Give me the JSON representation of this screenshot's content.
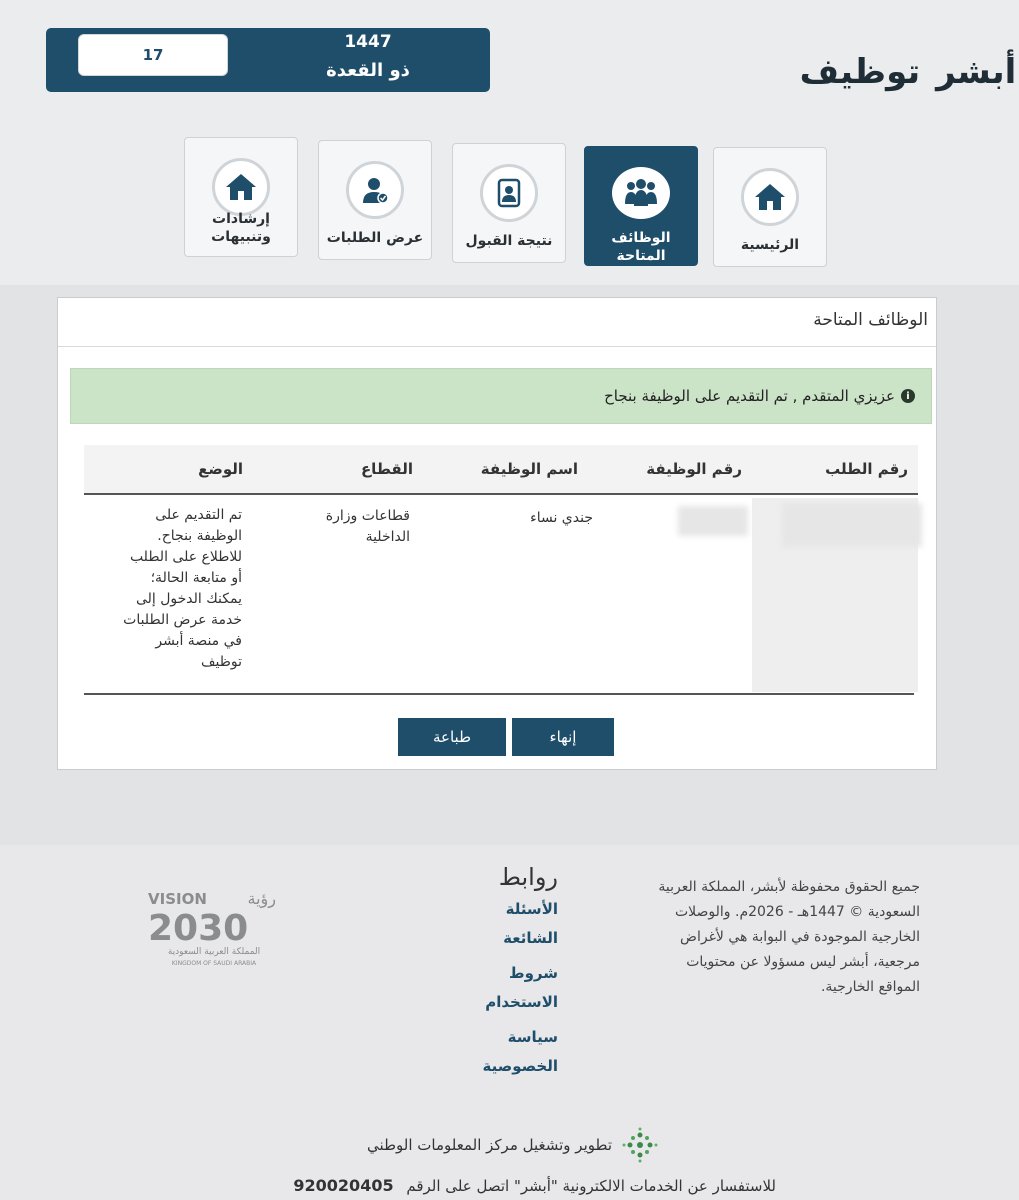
{
  "header": {
    "date": {
      "day": "17",
      "year": "1447",
      "month": "ذو القعدة"
    },
    "logo": {
      "part_a": "أبشر",
      "part_b": "توظيف"
    }
  },
  "nav": [
    {
      "label": "الرئيسية",
      "icon": "home-icon",
      "active": false
    },
    {
      "label": "الوظائف المتاحة",
      "icon": "people-group-icon",
      "active": true
    },
    {
      "label": "نتيجة القبول",
      "icon": "id-badge-icon",
      "active": false
    },
    {
      "label": "عرض الطلبات",
      "icon": "user-check-icon",
      "active": false
    },
    {
      "label": "إرشادات وتنبيهات",
      "icon": "home-icon",
      "active": false
    }
  ],
  "panel": {
    "title": "الوظائف المتاحة",
    "alert": "عزيزي المتقدم , تم التقديم على الوظيفة بنجاح"
  },
  "table": {
    "headers": [
      "رقم الطلب",
      "رقم الوظيفة",
      "اسم الوظيفة",
      "القطاع",
      "الوضع"
    ],
    "row": {
      "request_number": "",
      "job_number": "",
      "job_name": "جندي نساء",
      "sector_line1": "قطاعات وزارة",
      "sector_line2": "الداخلية",
      "status_lines": [
        "تم التقديم على",
        "الوظيفة بنجاح.",
        "للاطلاع على الطلب",
        "أو متابعة الحالة؛",
        "يمكنك الدخول إلى",
        "خدمة عرض الطلبات",
        "في منصة أبشر",
        "توظيف"
      ]
    }
  },
  "buttons": {
    "finish": "إنهاء",
    "print": "طباعة"
  },
  "footer": {
    "copyright_lines": [
      "جميع الحقوق محفوظة لأبشر، المملكة العربية",
      "السعودية © 1447هـ - 2026م. والوصلات",
      "الخارجية الموجودة في البوابة هي لأغراض",
      "مرجعية، أبشر ليس مسؤولا عن محتويات",
      "المواقع الخارجية."
    ],
    "links_title": "روابط",
    "links": [
      {
        "line1": "الأسئلة",
        "line2": "الشائعة"
      },
      {
        "line1": "شروط",
        "line2": "الاستخدام"
      },
      {
        "line1": "سياسة",
        "line2": "الخصوصية"
      }
    ],
    "vision": {
      "top_en": "VISION",
      "top_ar": "رؤية",
      "year": "2030",
      "sub_ar": "المملكة العربية السعودية",
      "sub_en": "KINGDOM OF SAUDI ARABIA"
    },
    "developer": "تطوير وتشغيل مركز المعلومات الوطني",
    "contact_text": "للاستفسار عن الخدمات الالكترونية \"أبشر\" اتصل على الرقم",
    "contact_number": "920020405"
  }
}
